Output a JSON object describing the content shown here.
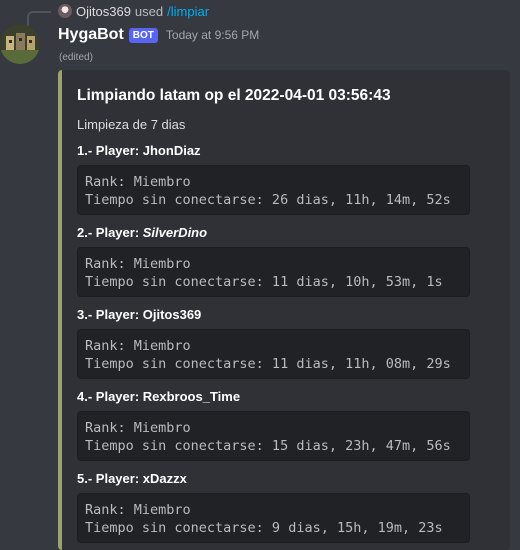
{
  "reply": {
    "user": "Ojitos369",
    "action": "used",
    "command": "/limpiar"
  },
  "message": {
    "username": "HygaBot",
    "bot_tag": "BOT",
    "timestamp": "Today at 9:56 PM",
    "edited": "(edited)"
  },
  "embed": {
    "accent_color": "#9ea26e",
    "title": "Limpiando latam op el 2022-04-01 03:56:43",
    "description": "Limpieza de 7 dias",
    "fields": [
      {
        "number": "1.- Player: ",
        "player": "JhonDiaz",
        "rank": "Rank: Miembro",
        "offline": "Tiempo sin conectarse: 26 dias, 11h, 14m, 52s"
      },
      {
        "number": "2.- Player: ",
        "player": "SilverDino",
        "rank": "Rank: Miembro",
        "offline": "Tiempo sin conectarse: 11 dias, 10h, 53m, 1s"
      },
      {
        "number": "3.- Player: ",
        "player": "Ojitos369",
        "rank": "Rank: Miembro",
        "offline": "Tiempo sin conectarse: 11 dias, 11h, 08m, 29s"
      },
      {
        "number": "4.- Player: ",
        "player": "Rexbroos_Time",
        "rank": "Rank: Miembro",
        "offline": "Tiempo sin conectarse: 15 dias, 23h, 47m, 56s"
      },
      {
        "number": "5.- Player: ",
        "player": "xDazzx",
        "rank": "Rank: Miembro",
        "offline": "Tiempo sin conectarse: 9 dias, 15h, 19m, 23s"
      }
    ]
  }
}
